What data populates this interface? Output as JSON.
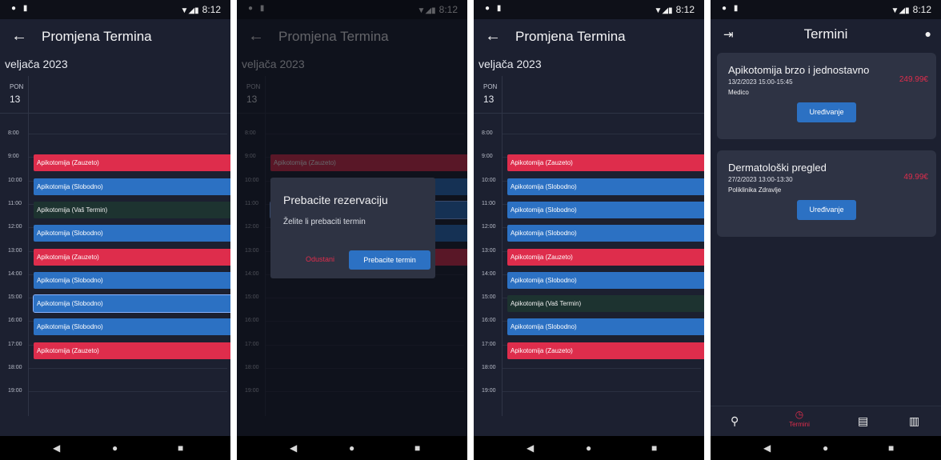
{
  "status": {
    "time": "8:12"
  },
  "calendar": {
    "title": "Promjena Termina",
    "month": "veljača 2023",
    "day_name": "PON",
    "day_number": "13",
    "hours": [
      "8:00",
      "9:00",
      "10:00",
      "11:00",
      "12:00",
      "13:00",
      "14:00",
      "15:00",
      "16:00",
      "17:00",
      "18:00",
      "19:00"
    ]
  },
  "screen1": {
    "slots": [
      {
        "label": "Apikotomija (Zauzeto)",
        "status": "Zauzeto"
      },
      {
        "label": "Apikotomija (Slobodno)",
        "status": "Slobodno"
      },
      {
        "label": "Apikotomija (Vaš Termin)",
        "status": "Vaš Termin"
      },
      {
        "label": "Apikotomija (Slobodno)",
        "status": "Slobodno"
      },
      {
        "label": "Apikotomija (Zauzeto)",
        "status": "Zauzeto"
      },
      {
        "label": "Apikotomija (Slobodno)",
        "status": "Slobodno"
      },
      {
        "label": "Apikotomija (Slobodno)",
        "status": "Slobodno",
        "selected": true
      },
      {
        "label": "Apikotomija (Slobodno)",
        "status": "Slobodno"
      },
      {
        "label": "Apikotomija (Zauzeto)",
        "status": "Zauzeto"
      }
    ]
  },
  "screen2": {
    "slots": [
      {
        "label": "Apikotomija (Zauzeto)",
        "status": "Zauzeto"
      },
      {
        "label": "Apikotomija (Slobodno)",
        "status": "Slobodno"
      },
      {
        "label": "Apikotomija (Slobodno)",
        "status": "Slobodno",
        "selected": true
      },
      {
        "label": "Apikotomija (Slobodno)",
        "status": "Slobodno"
      },
      {
        "label": "Apikotomija (Zauzeto)",
        "status": "Zauzeto"
      }
    ],
    "dialog": {
      "title": "Prebacite rezervaciju",
      "message": "Želite li prebaciti termin",
      "cancel_label": "Odustani",
      "confirm_label": "Prebacite termin"
    }
  },
  "screen3": {
    "slots": [
      {
        "label": "Apikotomija (Zauzeto)",
        "status": "Zauzeto"
      },
      {
        "label": "Apikotomija (Slobodno)",
        "status": "Slobodno"
      },
      {
        "label": "Apikotomija (Slobodno)",
        "status": "Slobodno"
      },
      {
        "label": "Apikotomija (Slobodno)",
        "status": "Slobodno"
      },
      {
        "label": "Apikotomija (Zauzeto)",
        "status": "Zauzeto"
      },
      {
        "label": "Apikotomija (Slobodno)",
        "status": "Slobodno"
      },
      {
        "label": "Apikotomija (Vaš Termin)",
        "status": "Vaš Termin"
      },
      {
        "label": "Apikotomija (Slobodno)",
        "status": "Slobodno"
      },
      {
        "label": "Apikotomija (Zauzeto)",
        "status": "Zauzeto"
      }
    ]
  },
  "termini": {
    "title": "Termini",
    "appointments": [
      {
        "title": "Apikotomija brzo i jednostavno",
        "datetime": "13/2/2023 15:00-15:45",
        "place": "Medico",
        "price": "249.99€",
        "button": "Uređivanje"
      },
      {
        "title": "Dermatološki pregled",
        "datetime": "27/2/2023 13:00-13:30",
        "place": "Poliklinika Zdravlje",
        "price": "49.99€",
        "button": "Uređivanje"
      }
    ],
    "bottom_nav": {
      "active_label": "Termini"
    }
  },
  "icons": {
    "back": "arrow-left-icon",
    "login": "login-icon",
    "person": "person-icon",
    "search": "search-icon",
    "clock": "clock-icon",
    "chat": "chat-icon",
    "map": "map-icon"
  },
  "colors": {
    "background": "#1c2030",
    "occupied": "#de2d4c",
    "free": "#2c71c3",
    "yours": "#1d3330",
    "card": "#2e3344",
    "accent": "#de2d4c"
  }
}
